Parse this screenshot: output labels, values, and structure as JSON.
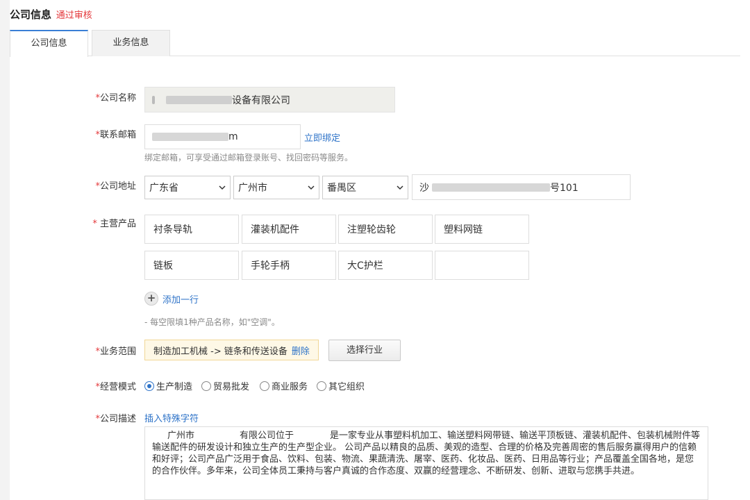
{
  "header": {
    "title": "公司信息",
    "status": "通过审核",
    "status_color": "#e4393c"
  },
  "tabs": [
    {
      "label": "公司信息",
      "active": true
    },
    {
      "label": "业务信息",
      "active": false
    }
  ],
  "form": {
    "company_name": {
      "label": "公司名称",
      "value_prefix": "",
      "value_visible": "设备有限公司"
    },
    "email": {
      "label": "联系邮箱",
      "value_visible": "m",
      "bind_link": "立即绑定",
      "hint": "绑定邮箱，可享受通过邮箱登录账号、找回密码等服务。"
    },
    "address": {
      "label": "公司地址",
      "province": "广东省",
      "city": "广州市",
      "district": "番禺区",
      "street_prefix": "沙",
      "street_suffix": "号101"
    },
    "products": {
      "label": "主营产品",
      "items": [
        "衬条导轨",
        "灌装机配件",
        "注塑轮齿轮",
        "塑料网链",
        "链板",
        "手轮手柄",
        "大C护栏",
        ""
      ],
      "add_row": "添加一行",
      "hint": "- 每空限填1种产品名称，如\"空调\"。"
    },
    "business_scope": {
      "label": "业务范围",
      "tag": "制造加工机械 -> 链条和传送设备",
      "delete": "删除",
      "select_button": "选择行业"
    },
    "business_mode": {
      "label": "经营模式",
      "options": [
        "生产制造",
        "贸易批发",
        "商业服务",
        "其它组织"
      ],
      "selected": "生产制造"
    },
    "description": {
      "label": "公司描述",
      "insert_link": "插入特殊字符",
      "text": "广州市　　　　　有限公司位于　　　　是一家专业从事塑料机加工、输送塑料网带链、输送平顶板链、灌装机配件、包装机械附件等输送配件的研发设计和独立生产的生产型企业。 公司产品以精良的品质、美观的造型、合理的价格及完善周密的售后服务赢得用户的信赖和好评；公司产品广泛用于食品、饮料、包装、物流、果蔬清洗、屠宰、医药、化妆品、医药、日用品等行业；产品覆盖全国各地，是您的合作伙伴。多年来，公司全体员工秉持与客户真诚的合作态度、双赢的经营理念、不断研发、创新、进取与您携手共进。"
    }
  }
}
